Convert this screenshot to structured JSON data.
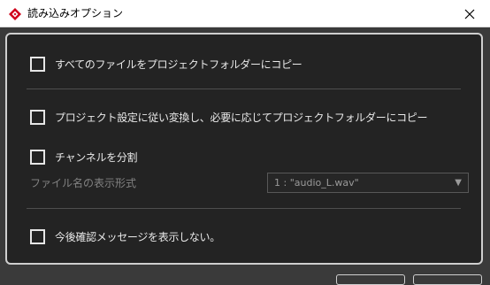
{
  "window": {
    "title": "読み込みオプション",
    "close_glyph": "✕"
  },
  "options": {
    "copy_all": {
      "label": "すべてのファイルをプロジェクトフォルダーにコピー",
      "checked": false
    },
    "convert_copy": {
      "label": "プロジェクト設定に従い変換し、必要に応じてプロジェクトフォルダーにコピー",
      "checked": false
    },
    "split_channels": {
      "label": "チャンネルを分割",
      "checked": false
    },
    "dont_show_again": {
      "label": "今後確認メッセージを表示しない。",
      "checked": false
    }
  },
  "filename_format": {
    "label": "ファイル名の表示形式",
    "selected": "1 : \"audio_L.wav\"",
    "arrow": "▼"
  },
  "colors": {
    "accent": "#d0021b",
    "panel_bg": "#232323",
    "text": "#e9e9e9",
    "disabled_text": "#828282"
  }
}
